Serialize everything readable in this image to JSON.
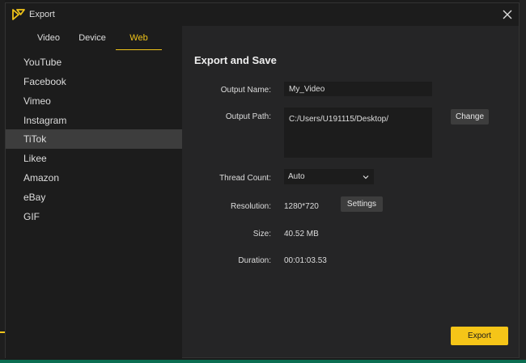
{
  "window": {
    "title": "Export"
  },
  "tabs": [
    "Video",
    "Device",
    "Web"
  ],
  "active_tab": "Web",
  "sidebar": {
    "items": [
      "YouTube",
      "Facebook",
      "Vimeo",
      "Instagram",
      "TiTok",
      "Likee",
      "Amazon",
      "eBay",
      "GIF"
    ],
    "selected": "TiTok"
  },
  "main": {
    "heading": "Export and Save",
    "output_name": {
      "label": "Output Name:",
      "value": "My_Video"
    },
    "output_path": {
      "label": "Output Path:",
      "value": "C:/Users/U191115/Desktop/",
      "button": "Change"
    },
    "thread_count": {
      "label": "Thread Count:",
      "value": "Auto"
    },
    "resolution": {
      "label": "Resolution:",
      "value": "1280*720",
      "button": "Settings"
    },
    "size": {
      "label": "Size:",
      "value": "40.52 MB"
    },
    "duration": {
      "label": "Duration:",
      "value": "00:01:03.53"
    },
    "export_button": "Export"
  },
  "colors": {
    "accent": "#f0c419",
    "export_button": "#f5c518",
    "background": "#252526",
    "sidebar": "#1c1c1c"
  },
  "icons": [
    "app-logo-icon",
    "close-icon",
    "chevron-down-icon"
  ]
}
